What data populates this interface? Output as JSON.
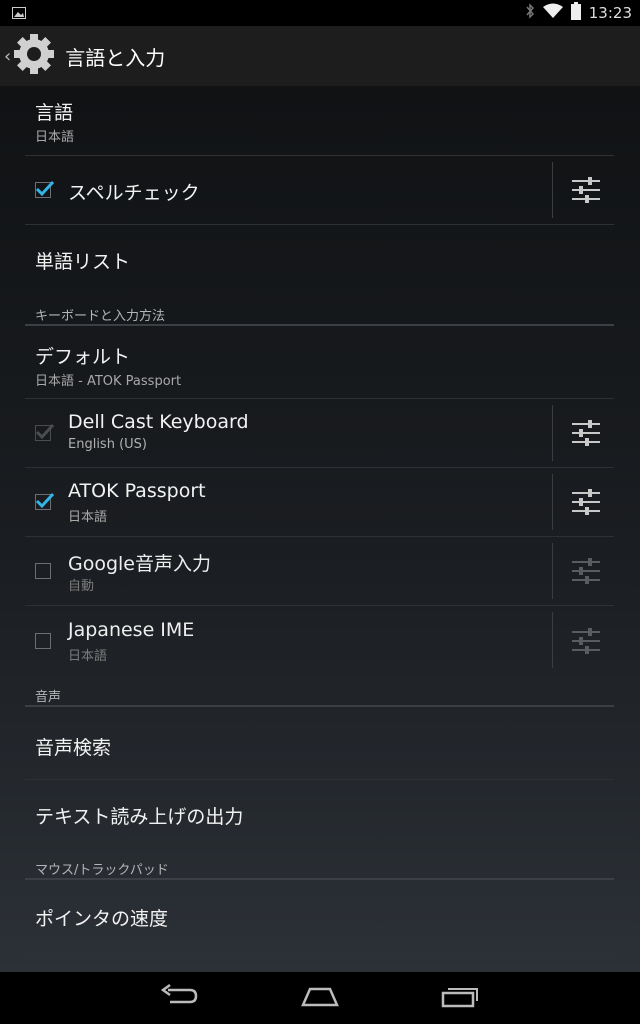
{
  "status": {
    "time": "13:23"
  },
  "actionbar": {
    "title": "言語と入力"
  },
  "rows": {
    "language": {
      "title": "言語",
      "sub": "日本語"
    },
    "spell": {
      "title": "スペルチェック",
      "checked": true
    },
    "wordlist": {
      "title": "単語リスト"
    },
    "kb_header": "キーボードと入力方法",
    "default": {
      "title": "デフォルト",
      "sub": "日本語 - ATOK Passport"
    },
    "dell": {
      "title": "Dell Cast Keyboard",
      "sub": "English (US)",
      "checked": true,
      "enabled": false
    },
    "atok": {
      "title": "ATOK Passport",
      "sub": "日本語",
      "checked": true,
      "enabled": true
    },
    "google": {
      "title": "Google音声入力",
      "sub": "自動",
      "checked": false,
      "enabled": true
    },
    "jime": {
      "title": "Japanese IME",
      "sub": "日本語",
      "checked": false,
      "enabled": true
    },
    "voice_header": "音声",
    "voicesearch": {
      "title": "音声検索"
    },
    "tts": {
      "title": "テキスト読み上げの出力"
    },
    "mouse_header": "マウス/トラックパッド",
    "pointer": {
      "title": "ポインタの速度"
    }
  },
  "colors": {
    "accent": "#33b5e5"
  }
}
